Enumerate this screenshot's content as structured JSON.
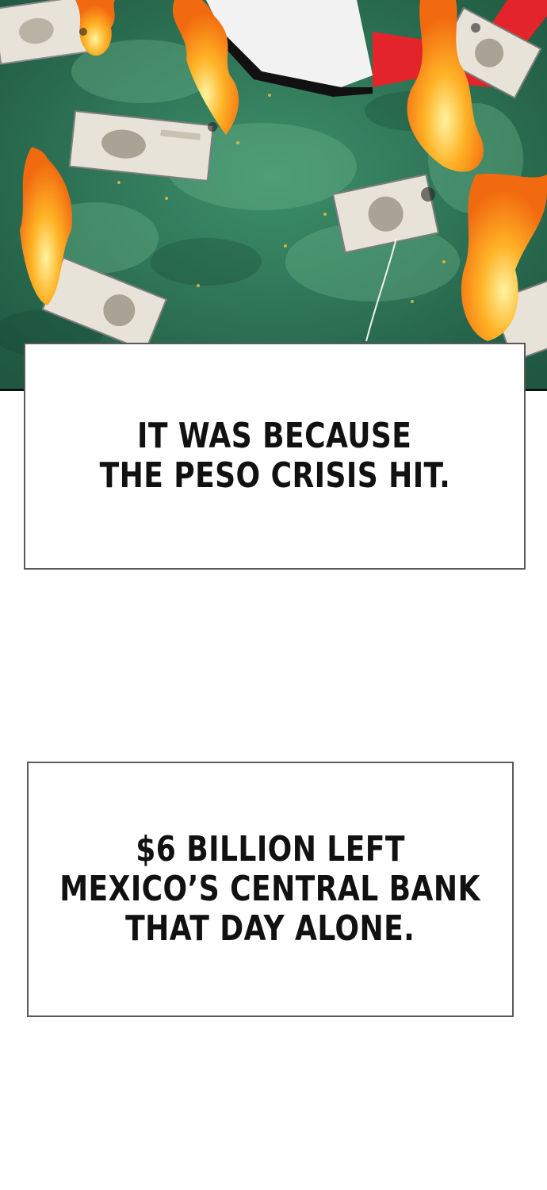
{
  "comic": {
    "panel": {
      "scene": "burning-banknotes",
      "colors": {
        "background": "#2f7a5a",
        "flag_red": "#e3242b",
        "flag_white": "#f2f2f2",
        "fire": "#ff8a1c",
        "note": "#e7e3d9"
      }
    },
    "captions": [
      {
        "lines": [
          "IT WAS BECAUSE",
          "THE PESO CRISIS HIT."
        ]
      },
      {
        "lines": [
          "$6 BILLION LEFT",
          "MEXICO’S CENTRAL BANK",
          "THAT DAY ALONE."
        ]
      }
    ]
  }
}
